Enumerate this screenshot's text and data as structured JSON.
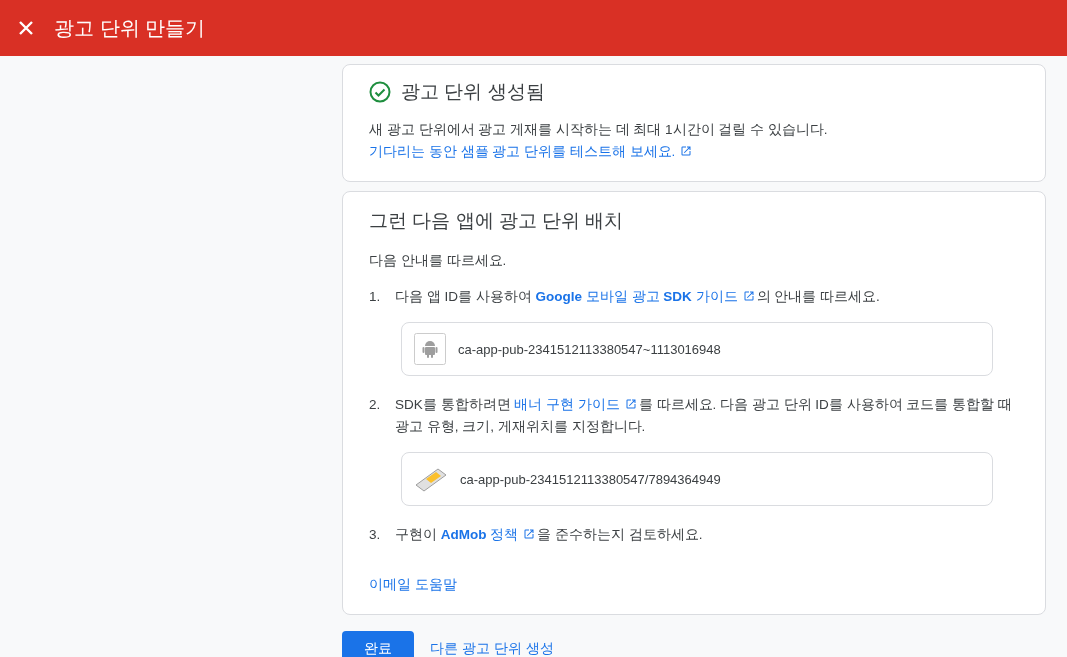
{
  "header": {
    "title": "광고 단위 만들기"
  },
  "status_card": {
    "title": "광고 단위 생성됨",
    "text": "새 광고 단위에서 광고 게재를 시작하는 데 최대 1시간이 걸릴 수 있습니다.",
    "link": "기다리는 동안 샘플 광고 단위를 테스트해 보세요."
  },
  "placement_card": {
    "title": "그런 다음 앱에 광고 단위 배치",
    "intro": "다음 안내를 따르세요.",
    "steps": [
      {
        "number": "1.",
        "parts": [
          {
            "kind": "text",
            "text": "다음 앱 ID를 사용하여 "
          },
          {
            "kind": "link",
            "text": "**Google** 모바일 광고 **SDK** 가이드"
          },
          {
            "kind": "text",
            "text": "의 안내를 따르세요."
          }
        ],
        "id_box": {
          "kind": "app",
          "value": "ca-app-pub-2341512113380547~1113016948"
        }
      },
      {
        "number": "2.",
        "parts": [
          {
            "kind": "text",
            "text": "SDK를 통합하려면 "
          },
          {
            "kind": "link",
            "text": "배너 구현 가이드"
          },
          {
            "kind": "text",
            "text": "를 따르세요. 다음 광고 단위 ID를 사용하여 코드를 통합할 때 광고 유형, 크기, 게재위치를 지정합니다."
          }
        ],
        "id_box": {
          "kind": "ad_unit",
          "value": "ca-app-pub-2341512113380547/7894364949"
        }
      },
      {
        "number": "3.",
        "parts": [
          {
            "kind": "text",
            "text": "구현이 "
          },
          {
            "kind": "link",
            "text": "**AdMob** 정책"
          },
          {
            "kind": "text",
            "text": "을 준수하는지 검토하세요."
          }
        ]
      }
    ],
    "help_link": "이메일 도움말"
  },
  "buttons": {
    "done": "완료",
    "create_another": "다른 광고 단위 생성"
  }
}
